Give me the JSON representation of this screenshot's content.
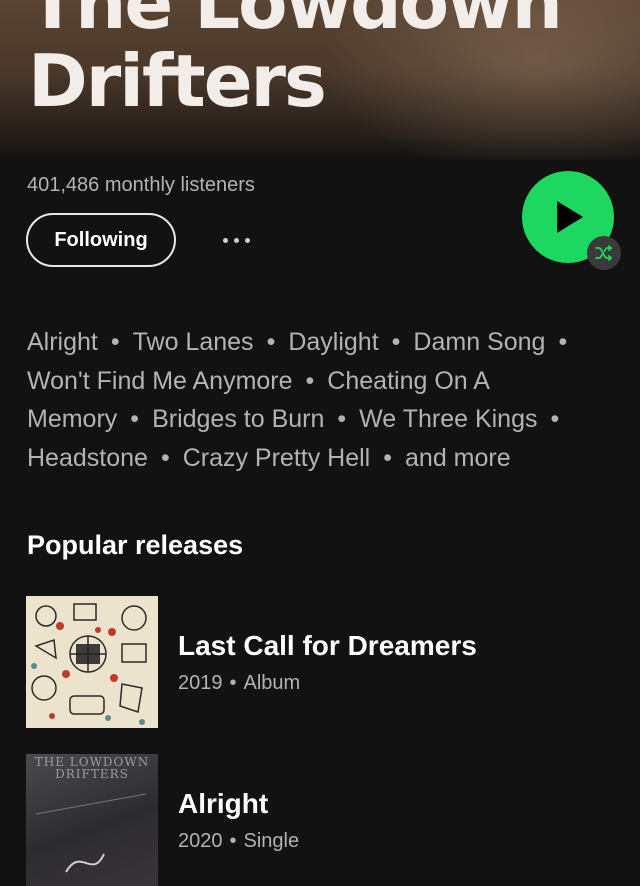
{
  "artist": {
    "name": "The Lowdown Drifters",
    "monthly_listeners": "401,486 monthly listeners"
  },
  "actions": {
    "follow_label": "Following",
    "more_icon": "more-horizontal-icon",
    "play_icon": "play-icon",
    "shuffle_icon": "shuffle-icon",
    "play_color": "#1ed760"
  },
  "popular_songs": [
    "Alright",
    "Two Lanes",
    "Daylight",
    "Damn Song",
    "Won't Find Me Anymore",
    "Cheating On A Memory",
    "Bridges to Burn",
    "We Three Kings",
    "Headstone",
    "Crazy Pretty Hell"
  ],
  "popular_songs_more": "and more",
  "separator": "•",
  "releases_section": {
    "title": "Popular releases",
    "items": [
      {
        "title": "Last Call for Dreamers",
        "year": "2019",
        "type": "Album"
      },
      {
        "title": "Alright",
        "year": "2020",
        "type": "Single",
        "cover_text": "THE LOWDOWN DRIFTERS"
      }
    ]
  }
}
